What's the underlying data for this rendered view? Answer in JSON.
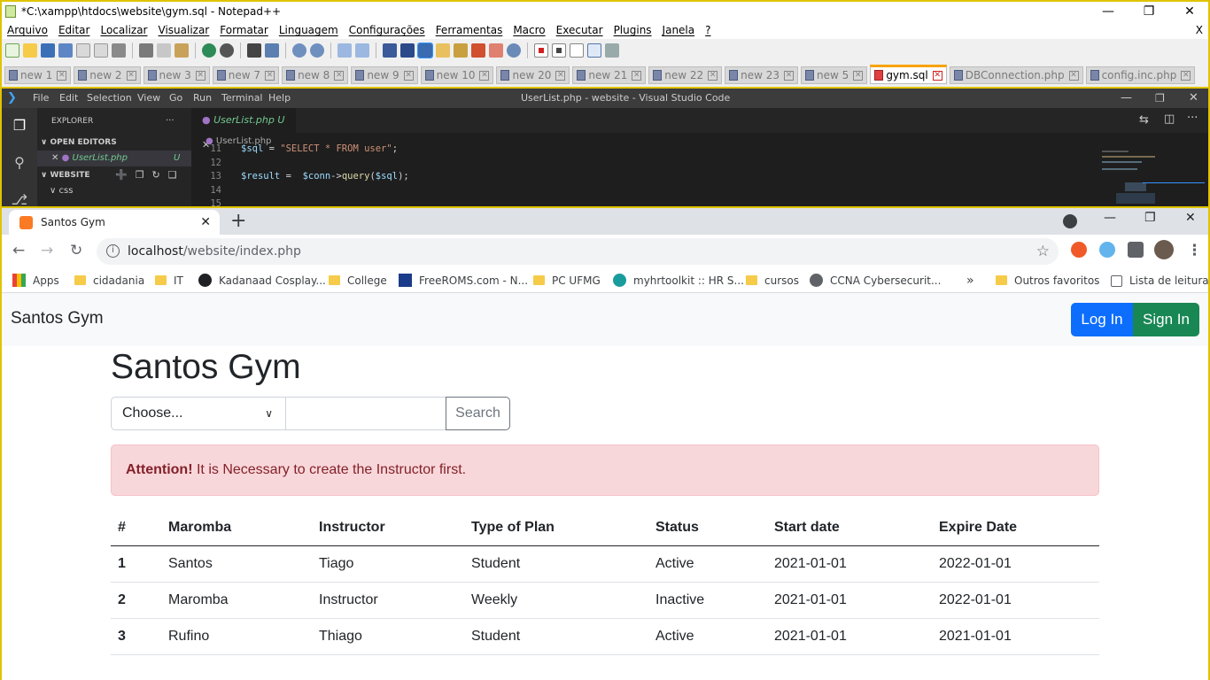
{
  "notepad": {
    "title": "*C:\\xampp\\htdocs\\website\\gym.sql - Notepad++",
    "menu": [
      "Arquivo",
      "Editar",
      "Localizar",
      "Visualizar",
      "Formatar",
      "Linguagem",
      "Configurações",
      "Ferramentas",
      "Macro",
      "Executar",
      "Plugins",
      "Janela",
      "?"
    ],
    "close_doc": "X",
    "tabs": [
      "new 1",
      "new 2",
      "new 3",
      "new 7",
      "new 8",
      "new 9",
      "new 10",
      "new 20",
      "new 21",
      "new 22",
      "new 23",
      "new 5",
      "gym.sql",
      "DBConnection.php",
      "config.inc.php"
    ],
    "active_tab": "gym.sql"
  },
  "vscode": {
    "menu": [
      "File",
      "Edit",
      "Selection",
      "View",
      "Go",
      "Run",
      "Terminal",
      "Help"
    ],
    "title": "UserList.php - website - Visual Studio Code",
    "explorer_label": "EXPLORER",
    "open_editors": "OPEN EDITORS",
    "open_file": "UserList.php",
    "untracked": "U",
    "workspace": "WEBSITE",
    "folder": "css",
    "tab": "UserList.php",
    "tab_badge": "U",
    "breadcrumb": "UserList.php",
    "code": [
      {
        "n": "11",
        "parts": [
          {
            "c": "v",
            "t": "$sql"
          },
          {
            "c": "w",
            "t": " = "
          },
          {
            "c": "s",
            "t": "\"SELECT * FROM user\""
          },
          {
            "c": "w",
            "t": ";"
          }
        ]
      },
      {
        "n": "12",
        "parts": []
      },
      {
        "n": "13",
        "parts": [
          {
            "c": "v",
            "t": "$result"
          },
          {
            "c": "w",
            "t": " =  "
          },
          {
            "c": "v",
            "t": "$conn"
          },
          {
            "c": "w",
            "t": "->"
          },
          {
            "c": "f",
            "t": "query"
          },
          {
            "c": "w",
            "t": "("
          },
          {
            "c": "v",
            "t": "$sql"
          },
          {
            "c": "w",
            "t": ");"
          }
        ]
      },
      {
        "n": "14",
        "parts": []
      },
      {
        "n": "15",
        "parts": []
      }
    ]
  },
  "chrome": {
    "tab_title": "Santos Gym",
    "url_host": "localhost",
    "url_path": "/website/index.php",
    "bookmarks": [
      "Apps",
      "cidadania",
      "IT",
      "Kadanaad Cosplay...",
      "College",
      "FreeROMS.com - N...",
      "PC UFMG",
      "myhrtoolkit :: HR S...",
      "cursos",
      "CCNA Cybersecurit..."
    ],
    "overflow": "»",
    "other_favorites": "Outros favoritos",
    "reading_list": "Lista de leitura"
  },
  "page": {
    "brand": "Santos Gym",
    "login": "Log In",
    "signin": "Sign In",
    "heading": "Santos Gym",
    "select_value": "Choose...",
    "search_button": "Search",
    "alert_strong": "Attention!",
    "alert_text": " It is Necessary to create the Instructor first.",
    "columns": [
      "#",
      "Maromba",
      "Instructor",
      "Type of Plan",
      "Status",
      "Start date",
      "Expire Date"
    ],
    "rows": [
      [
        "1",
        "Santos",
        "Tiago",
        "Student",
        "Active",
        "2021-01-01",
        "2022-01-01"
      ],
      [
        "2",
        "Maromba",
        "Instructor",
        "Weekly",
        "Inactive",
        "2021-01-01",
        "2022-01-01"
      ],
      [
        "3",
        "Rufino",
        "Thiago",
        "Student",
        "Active",
        "2021-01-01",
        "2021-01-01"
      ]
    ]
  }
}
